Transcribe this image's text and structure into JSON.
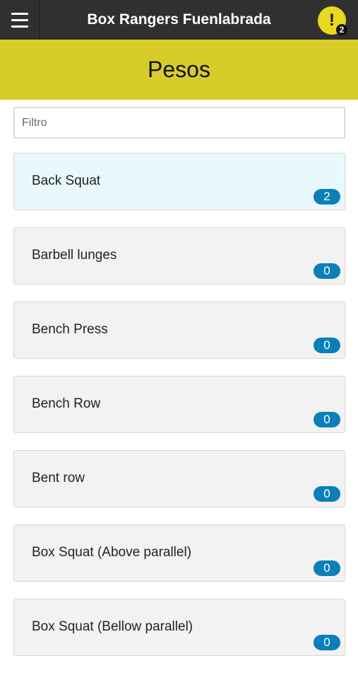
{
  "topbar": {
    "title": "Box Rangers Fuenlabrada",
    "notification_count": "2"
  },
  "page": {
    "title": "Pesos"
  },
  "filter": {
    "placeholder": "Filtro",
    "value": ""
  },
  "exercises": [
    {
      "name": "Back Squat",
      "count": "2",
      "active": true
    },
    {
      "name": "Barbell lunges",
      "count": "0",
      "active": false
    },
    {
      "name": "Bench Press",
      "count": "0",
      "active": false
    },
    {
      "name": "Bench Row",
      "count": "0",
      "active": false
    },
    {
      "name": "Bent row",
      "count": "0",
      "active": false
    },
    {
      "name": "Box Squat (Above parallel)",
      "count": "0",
      "active": false
    },
    {
      "name": "Box Squat (Bellow parallel)",
      "count": "0",
      "active": false
    }
  ],
  "colors": {
    "topbar": "#303030",
    "accent_yellow": "#d8cc2a",
    "badge_blue": "#0b7fb8",
    "active_card": "#e9f8fc"
  }
}
